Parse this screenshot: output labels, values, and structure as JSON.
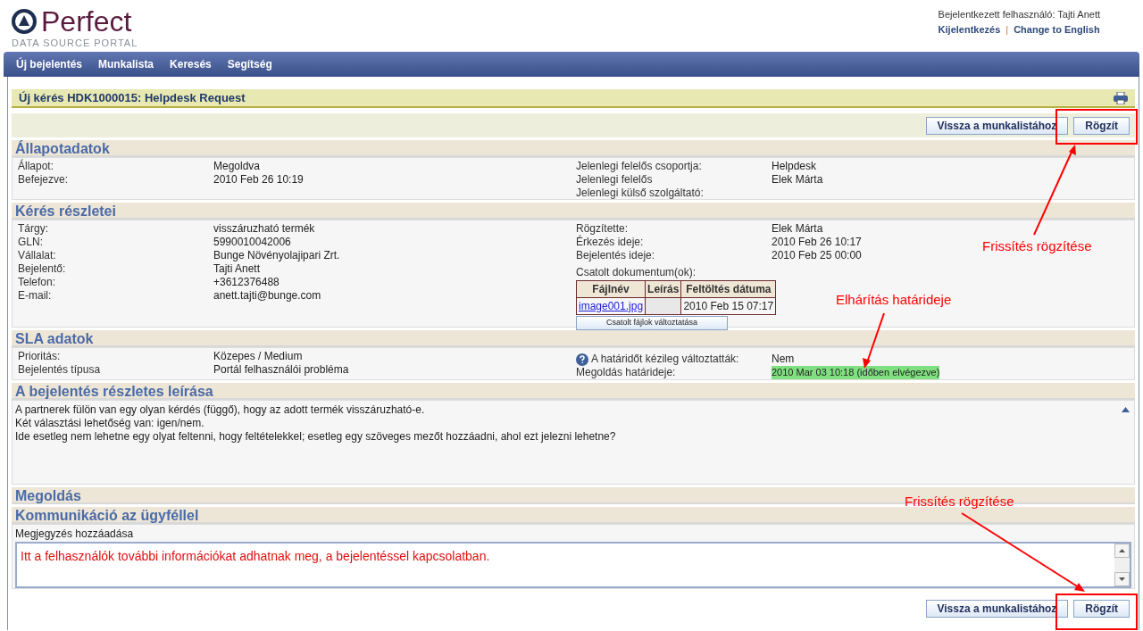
{
  "logo": {
    "name": "Perfect",
    "tagline": "DATA SOURCE PORTAL"
  },
  "user": {
    "label": "Bejelentkezett felhasználó: Tajti Anett",
    "links": [
      "Kijelentkezés",
      "Change to English"
    ],
    "separator": "|"
  },
  "nav": [
    "Új bejelentés",
    "Munkalista",
    "Keresés",
    "Segítség"
  ],
  "title": "Új kérés HDK1000015: Helpdesk Request",
  "top_buttons": [
    "Vissza a munkalistához",
    "Rögzít"
  ],
  "bottom_buttons": [
    "Vissza a munkalistához",
    "Rögzít"
  ],
  "sections": {
    "status": {
      "title": "Állapotadatok",
      "left": [
        {
          "label": "Állapot:",
          "value": "Megoldva"
        },
        {
          "label": "Befejezve:",
          "value": "2010 Feb 26 10:19"
        }
      ],
      "right": [
        {
          "label": "Jelenlegi felelős csoportja:",
          "value": "Helpdesk"
        },
        {
          "label": "Jelenlegi felelős",
          "value": "Elek Márta"
        },
        {
          "label": "Jelenlegi külső szolgáltató:"
        }
      ]
    },
    "details": {
      "title": "Kérés részletei",
      "left": [
        {
          "label": "Tárgy:",
          "value": "visszáruzható termék"
        },
        {
          "label": "GLN:",
          "value": "5990010042006"
        },
        {
          "label": "Vállalat:",
          "value": "Bunge Növényolajipari Zrt."
        },
        {
          "label": "Bejelentő:",
          "value": "Tajti Anett"
        },
        {
          "label": "Telefon:",
          "value": "+3612376488"
        },
        {
          "label": "E-mail:",
          "value": "anett.tajti@bunge.com"
        }
      ],
      "right": [
        {
          "label": "Rögzítette:",
          "value": "Elek Márta"
        },
        {
          "label": "Érkezés ideje:",
          "value": "2010 Feb 26 10:17"
        },
        {
          "label": "Bejelentés ideje:",
          "value": "2010 Feb 25 00:00"
        }
      ],
      "attachments": {
        "label": "Csatolt dokumentum(ok):",
        "columns": [
          "Fájlnév",
          "Leírás",
          "Feltöltés dátuma"
        ],
        "rows": [
          {
            "file": "image001.jpg",
            "description": "",
            "date": "2010 Feb 15 07:17"
          }
        ],
        "button": "Csatolt fájlok változtatása"
      }
    },
    "sla": {
      "title": "SLA adatok",
      "left": [
        {
          "label": "Prioritás:",
          "value": "Közepes / Medium"
        },
        {
          "label": "Bejelentés típusa",
          "value": "Portál felhasználói probléma"
        }
      ],
      "right": [
        {
          "kind": "help",
          "label": "A határidőt kézileg változtatták:",
          "value": "Nem",
          "highlighted": false
        },
        {
          "kind": "plain",
          "label": "Megoldás határideje:",
          "value": "2010 Mar 03 10:18 (időben elvégezve)",
          "highlighted": true
        }
      ]
    },
    "description": {
      "title": "A bejelentés részletes leírása",
      "lines": [
        "A partnerek fülön van egy olyan kérdés (függő), hogy az adott termék visszáruzható-e.",
        "Két választási lehetőség van: igen/nem.",
        "Ide esetleg nem lehetne egy olyat feltenni, hogy feltételekkel; esetleg egy szöveges mezőt hozzáadni, ahol ezt jelezni lehetne?"
      ]
    },
    "solution": {
      "title": "Megoldás"
    },
    "communication": {
      "title": "Kommunikáció az ügyféllel",
      "field_label": "Megjegyzés hozzáadása",
      "value": "Itt a felhasználók további információkat adhatnak meg, a bejelentéssel kapcsolatban."
    }
  },
  "annotations": [
    "Frissítés rögzítése",
    "Elhárítás határideje",
    "Frissítés rögzítése"
  ]
}
